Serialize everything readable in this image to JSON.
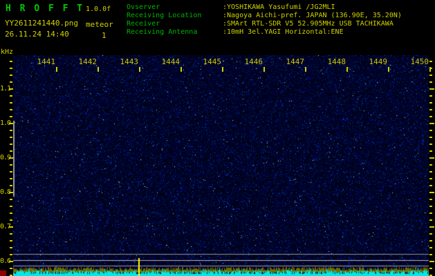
{
  "header": {
    "app_name": "H R O F F T",
    "version": "1.0.0f",
    "filename": "YY2611241440.png",
    "mode": "meteor",
    "datetime": "26.11.24 14:40",
    "count": "1",
    "info": [
      {
        "label": "Ovserver",
        "value": ":YOSHIKAWA Yasufumi /JG2MLI"
      },
      {
        "label": "Receiving Location",
        "value": ":Nagoya Aichi-pref. JAPAN (136.90E, 35.20N)"
      },
      {
        "label": "Receiver",
        "value": ":SMArt RTL-SDR V5 52.905MHz USB TACHIKAWA"
      },
      {
        "label": "Receiving Antenna",
        "value": ":10mH 3el.YAGI Horizontal:ENE"
      }
    ]
  },
  "colors": {
    "background": "#000000",
    "green_text": "#00c800",
    "yellow_text": "#d0d000",
    "bright_yellow": "#ffff00",
    "cyan_trace": "#00e8e8",
    "olive_trace": "#6f6f00",
    "gray_line": "#b4b4b4",
    "red_block": "#8f0000"
  },
  "chart_data": {
    "type": "heatmap",
    "title": "",
    "ylabel": "kHz",
    "x_tick_labels": [
      "1441",
      "1442",
      "1443",
      "1444",
      "1445",
      "1446",
      "1447",
      "1448",
      "1449",
      "1450"
    ],
    "y_tick_labels": [
      "1.1",
      "1.0",
      "0.9",
      "0.8",
      "0.7",
      "0.6"
    ],
    "x_start_hhmm": "14:40",
    "x_end_hhmm": "14:50",
    "y_top_khz": 1.2,
    "y_bottom_khz": 0.56,
    "grid": "off",
    "legend": "none",
    "features": {
      "carrier_lines_khz": [
        0.62,
        0.6,
        0.585
      ],
      "startup_marker": {
        "x_hhmm": "14:40",
        "khz_from": 0.8,
        "khz_to": 1.0,
        "color": "gray"
      },
      "echo_spike": {
        "x_hhmm": "14:43",
        "khz_near": 0.6,
        "color": "yellow"
      },
      "noise_level_trace": "cyan strip along bottom edge",
      "background": "dark-blue random noise speckle"
    }
  }
}
